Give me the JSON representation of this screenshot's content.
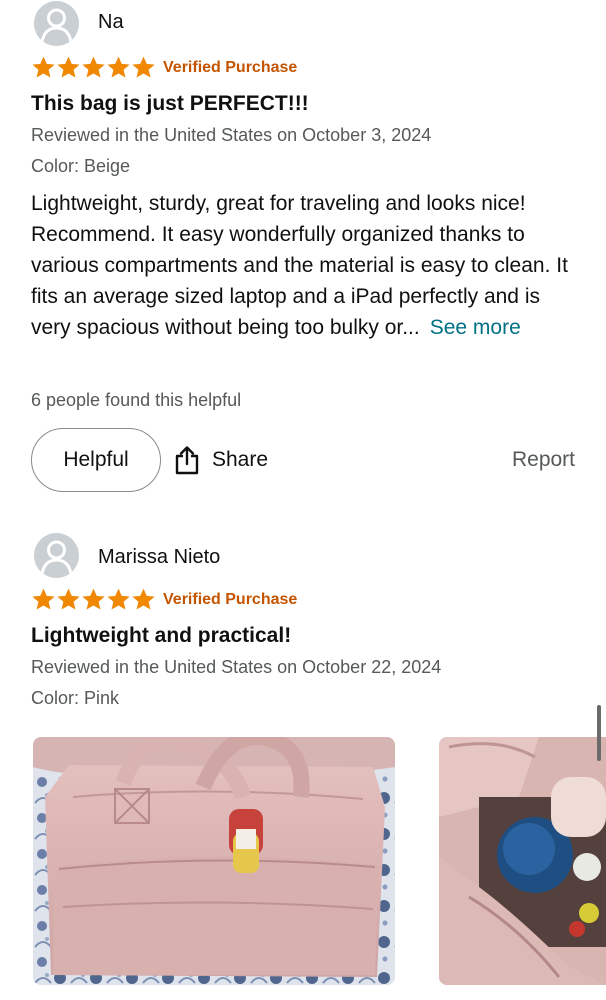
{
  "reviews": [
    {
      "reviewer": "Na",
      "rating": 5,
      "verified_label": "Verified Purchase",
      "title": "This bag is just PERFECT!!!",
      "date_line": "Reviewed in the United States on October 3, 2024",
      "color_line": "Color: Beige",
      "body": "Lightweight, sturdy, great for traveling and looks nice! Recommend. It easy wonderfully organized thanks to various compartments and the material is easy to clean. It fits an average sized laptop and a iPad perfectly and is very spacious without being too bulky or...",
      "see_more": "See more",
      "helpful_count": "6 people found this helpful",
      "helpful_button": "Helpful",
      "share_button": "Share",
      "report_link": "Report"
    },
    {
      "reviewer": "Marissa Nieto",
      "rating": 5,
      "verified_label": "Verified Purchase",
      "title": "Lightweight and practical!",
      "date_line": "Reviewed in the United States on October 22, 2024",
      "color_line": "Color: Pink",
      "photos": [
        "pink-tote-bag-photo",
        "bag-interior-photo"
      ]
    }
  ],
  "colors": {
    "star": "#f08804",
    "verified": "#c45500",
    "link": "#007185",
    "secondary_text": "#565959"
  }
}
